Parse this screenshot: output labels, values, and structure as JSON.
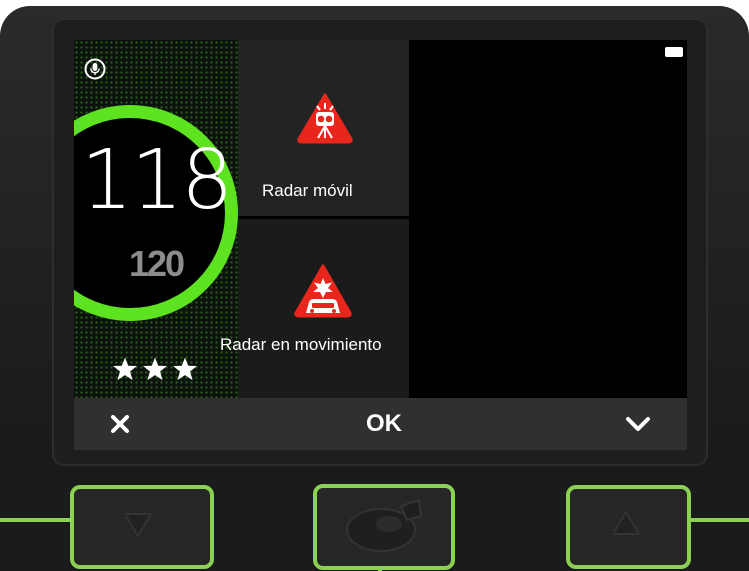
{
  "screen": {
    "speed": "118",
    "speed_limit": "120",
    "rating_stars": 3,
    "alerts": [
      {
        "label": "Radar móvil",
        "icon": "mobile-radar-icon"
      },
      {
        "label": "Radar en movimiento",
        "icon": "moving-radar-icon"
      }
    ],
    "status": {
      "mic_icon": "microphone-icon",
      "battery_icon": "battery-icon"
    },
    "action_bar": {
      "close_icon": "close-icon",
      "ok_label": "OK",
      "down_icon": "chevron-down-icon"
    }
  },
  "hardware_buttons": [
    {
      "name": "down",
      "icon": "triangle-down-icon"
    },
    {
      "name": "center",
      "icon": "center-button-icon"
    },
    {
      "name": "up",
      "icon": "triangle-up-icon"
    }
  ],
  "colors": {
    "speed_ring": "#5de31f",
    "highlight": "#8bd153",
    "alert_red": "#e8261c"
  }
}
